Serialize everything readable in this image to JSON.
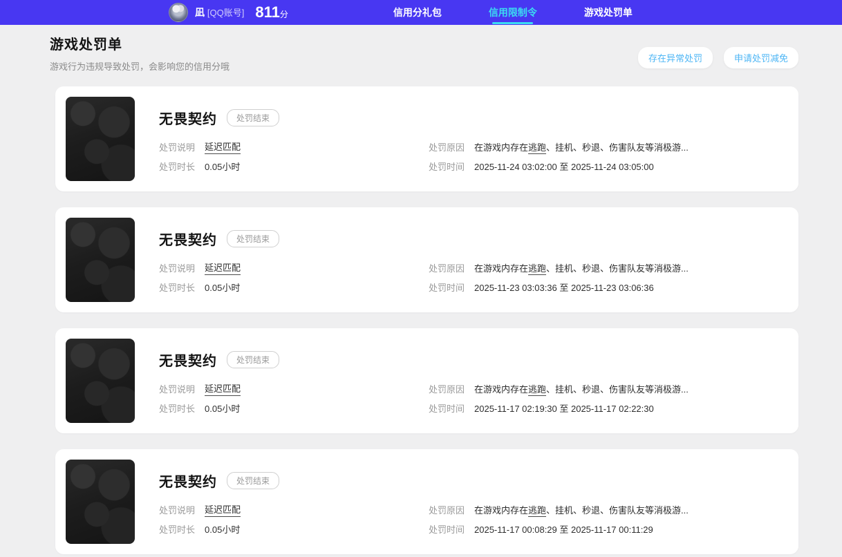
{
  "header": {
    "user": {
      "name": "凪",
      "account_type": "[QQ账号]",
      "score": "811",
      "score_unit": "分"
    },
    "tabs": [
      {
        "label": "信用分礼包",
        "active": false
      },
      {
        "label": "信用限制令",
        "active": true
      },
      {
        "label": "游戏处罚单",
        "active": false
      }
    ]
  },
  "page": {
    "title": "游戏处罚单",
    "subtitle": "游戏行为违规导致处罚，会影响您的信用分哦",
    "actions": [
      {
        "label": "存在异常处罚"
      },
      {
        "label": "申请处罚减免"
      }
    ]
  },
  "labels": {
    "explain": "处罚说明",
    "duration": "处罚时长",
    "reason": "处罚原因",
    "time": "处罚时间"
  },
  "cards": [
    {
      "game": "无畏契约",
      "status": "处罚结束",
      "explain": "延迟匹配",
      "duration": "0.05小时",
      "reason_prefix": "在游戏内存在",
      "reason_term": "逃跑",
      "reason_suffix": "、挂机、秒退、伤害队友等消极游...",
      "time": "2025-11-24 03:02:00 至 2025-11-24 03:05:00"
    },
    {
      "game": "无畏契约",
      "status": "处罚结束",
      "explain": "延迟匹配",
      "duration": "0.05小时",
      "reason_prefix": "在游戏内存在",
      "reason_term": "逃跑",
      "reason_suffix": "、挂机、秒退、伤害队友等消极游...",
      "time": "2025-11-23 03:03:36 至 2025-11-23 03:06:36"
    },
    {
      "game": "无畏契约",
      "status": "处罚结束",
      "explain": "延迟匹配",
      "duration": "0.05小时",
      "reason_prefix": "在游戏内存在",
      "reason_term": "逃跑",
      "reason_suffix": "、挂机、秒退、伤害队友等消极游...",
      "time": "2025-11-17 02:19:30 至 2025-11-17 02:22:30"
    },
    {
      "game": "无畏契约",
      "status": "处罚结束",
      "explain": "延迟匹配",
      "duration": "0.05小时",
      "reason_prefix": "在游戏内存在",
      "reason_term": "逃跑",
      "reason_suffix": "、挂机、秒退、伤害队友等消极游...",
      "time": "2025-11-17 00:08:29 至 2025-11-17 00:11:29"
    }
  ],
  "colors": {
    "topbar_bg": "#4837f2",
    "active_tab": "#3bdcf2",
    "action_text": "#4eb6f5",
    "page_bg": "#efeff0",
    "card_bg": "#ffffff",
    "label_gray": "#9a9a9a",
    "value_dark": "#2e2e2e"
  }
}
